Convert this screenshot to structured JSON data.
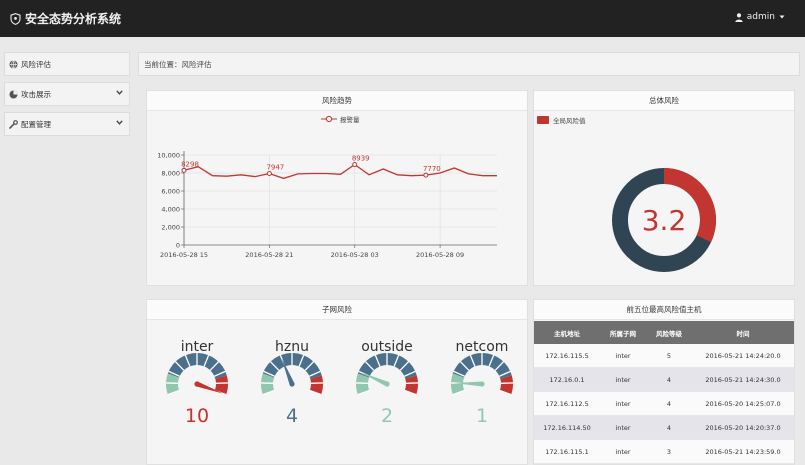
{
  "header": {
    "title": "安全态势分析系统",
    "user": "admin"
  },
  "sidebar": {
    "items": [
      {
        "label": "风险评估",
        "icon": "globe-icon"
      },
      {
        "label": "攻击展示",
        "icon": "pie-icon"
      },
      {
        "label": "配置管理",
        "icon": "wrench-icon"
      }
    ]
  },
  "breadcrumb": "当前位置：风险评估",
  "trend": {
    "title": "风险趋势",
    "legend": "报警量",
    "color": "#c23531"
  },
  "total": {
    "title": "总体风险",
    "legend": "全局风险值",
    "value": "3.2",
    "value_num": 3.2,
    "max": 10,
    "colors": {
      "risk": "#c23531",
      "rest": "#2f4554"
    }
  },
  "subnet": {
    "title": "子网风险",
    "gauges": [
      {
        "name": "inter",
        "value": "10",
        "value_num": 10,
        "color": "#c23531"
      },
      {
        "name": "hznu",
        "value": "4",
        "value_num": 4,
        "color": "#4a708b"
      },
      {
        "name": "outside",
        "value": "2",
        "value_num": 2,
        "color": "#91c7ae"
      },
      {
        "name": "netcom",
        "value": "1",
        "value_num": 1,
        "color": "#91c7ae"
      }
    ]
  },
  "top5": {
    "title": "前五位最高风险值主机",
    "columns": [
      "主机地址",
      "所属子网",
      "风险等级",
      "时间"
    ],
    "rows": [
      [
        "172.16.115.5",
        "inter",
        "5",
        "2016-05-21 14:24:20.0"
      ],
      [
        "172.16.0.1",
        "inter",
        "4",
        "2016-05-21 14:24:30.0"
      ],
      [
        "172.16.112.5",
        "inter",
        "4",
        "2016-05-20 14:25:07.0"
      ],
      [
        "172.16.114.50",
        "inter",
        "4",
        "2016-05-20 14:20:37.0"
      ],
      [
        "172.16.115.1",
        "inter",
        "3",
        "2016-05-21 14:23:59.0"
      ]
    ]
  },
  "chart_data": [
    {
      "type": "line",
      "series": [
        {
          "name": "报警量",
          "values": [
            8298,
            8700,
            7700,
            7650,
            7800,
            7600,
            7947,
            7400,
            7900,
            7950,
            7950,
            7850,
            8939,
            7800,
            8450,
            7800,
            7700,
            7770,
            8000,
            8550,
            7900,
            7700,
            7700
          ]
        }
      ],
      "ylim": [
        0,
        10000
      ],
      "yticks": [
        "0",
        "2,000",
        "4,000",
        "6,000",
        "8,000",
        "10,000"
      ],
      "xticks": [
        {
          "index": 0,
          "label": "2016-05-28 15"
        },
        {
          "index": 6,
          "label": "2016-05-28 21"
        },
        {
          "index": 12,
          "label": "2016-05-28 03"
        },
        {
          "index": 18,
          "label": "2016-05-28 09"
        }
      ],
      "labels": [
        {
          "index": 0,
          "text": "8298"
        },
        {
          "index": 6,
          "text": "7947"
        },
        {
          "index": 12,
          "text": "8939"
        },
        {
          "index": 17,
          "text": "7770"
        }
      ]
    },
    {
      "type": "pie",
      "categories": [
        "全局风险值"
      ],
      "values": [
        3.2
      ],
      "total": 10
    }
  ]
}
